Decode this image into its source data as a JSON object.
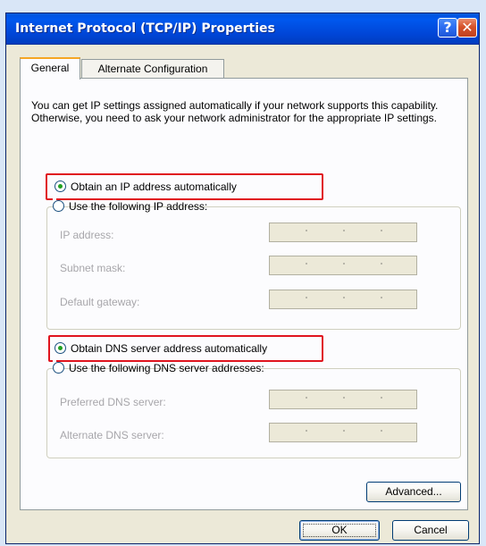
{
  "window": {
    "title": "Internet Protocol (TCP/IP) Properties",
    "help_icon": "?",
    "close_icon": "✕"
  },
  "tabs": [
    {
      "label": "General",
      "selected": true
    },
    {
      "label": "Alternate Configuration",
      "selected": false
    }
  ],
  "description": "You can get IP settings assigned automatically if your network supports this capability. Otherwise, you need to ask your network administrator for the appropriate IP settings.",
  "ip": {
    "auto_label": "Obtain an IP address automatically",
    "auto_selected": true,
    "manual_label": "Use the following IP address:",
    "manual_selected": false,
    "fields": [
      {
        "label": "IP address:",
        "value": ""
      },
      {
        "label": "Subnet mask:",
        "value": ""
      },
      {
        "label": "Default gateway:",
        "value": ""
      }
    ]
  },
  "dns": {
    "auto_label": "Obtain DNS server address automatically",
    "auto_selected": true,
    "manual_label": "Use the following DNS server addresses:",
    "manual_selected": false,
    "fields": [
      {
        "label": "Preferred DNS server:",
        "value": ""
      },
      {
        "label": "Alternate DNS server:",
        "value": ""
      }
    ]
  },
  "buttons": {
    "advanced": "Advanced...",
    "ok": "OK",
    "cancel": "Cancel"
  },
  "colors": {
    "titlebar": "#0054e3",
    "highlight": "#e0141e",
    "radio_dot": "#21a121",
    "disabled_text": "#a7a6aa"
  }
}
